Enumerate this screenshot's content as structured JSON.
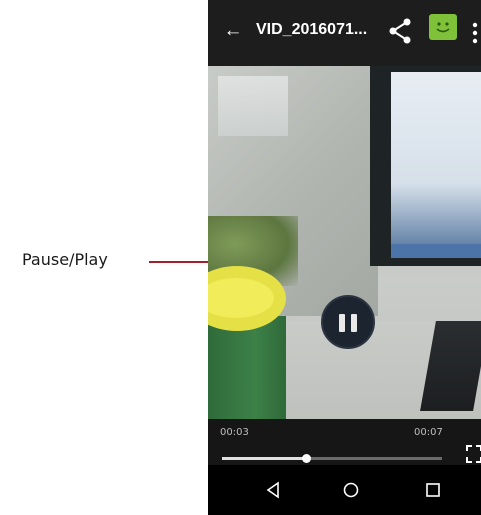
{
  "annotation": {
    "label": "Pause/Play"
  },
  "action_bar": {
    "title": "VID_2016071...",
    "icons": [
      "back-arrow-icon",
      "share-icon",
      "message-icon",
      "overflow-menu-icon"
    ]
  },
  "player": {
    "state": "playing",
    "current_time": "00:03",
    "total_time": "00:07",
    "progress_fraction": 0.38
  },
  "navigation": {
    "icons": [
      "nav-back-icon",
      "nav-home-icon",
      "nav-recents-icon"
    ]
  },
  "colors": {
    "callout_line": "#a51f2a",
    "message_icon_green": "#7fc23a",
    "pause_button_bg": "#1c2430"
  }
}
